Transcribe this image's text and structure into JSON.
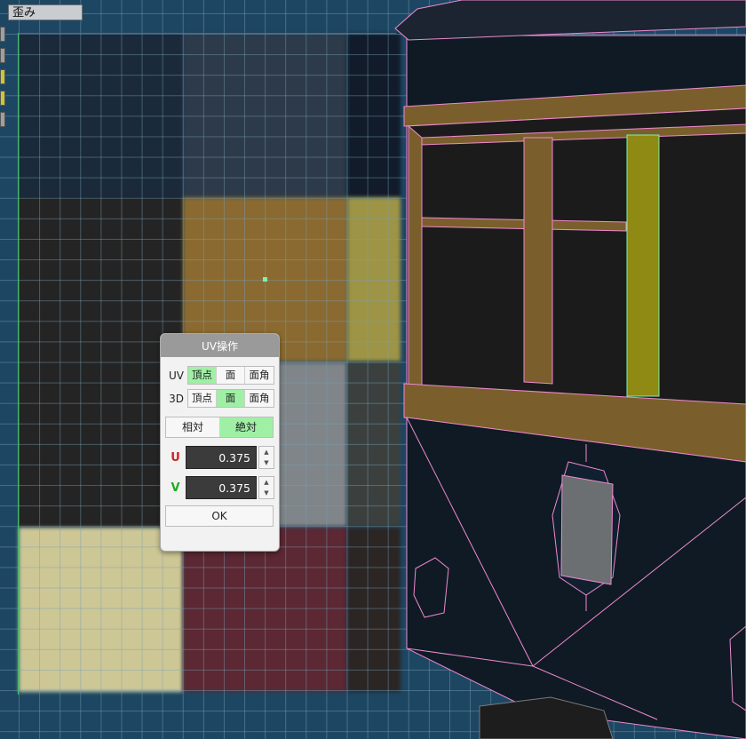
{
  "toolbar": {
    "distortion_label": "歪み",
    "swatch_colors": [
      "#9aa0a6",
      "#9aa0a6",
      "#c8c83a",
      "#c8c83a",
      "#9aa0a6"
    ]
  },
  "dialog": {
    "title": "UV操作",
    "uv_row": {
      "label": "UV",
      "options": [
        "頂点",
        "面",
        "面角"
      ],
      "selected": "頂点"
    },
    "three_d_row": {
      "label": "3D",
      "options": [
        "頂点",
        "面",
        "面角"
      ],
      "selected": "面"
    },
    "mode": {
      "options": [
        "相対",
        "絶対"
      ],
      "selected": "絶対"
    },
    "u": {
      "label": "U",
      "value": "0.375",
      "color": "#cc2222",
      "up_icon": "▲",
      "down_icon": "▼"
    },
    "v": {
      "label": "V",
      "value": "0.375",
      "color": "#22aa22",
      "up_icon": "▲",
      "down_icon": "▼"
    },
    "ok_label": "OK"
  },
  "colors": {
    "active_segment": "#9ff0a5",
    "wireframe": "#f08ad0",
    "selected_face": "#8f8a14",
    "wood": "#7a5f2c"
  }
}
